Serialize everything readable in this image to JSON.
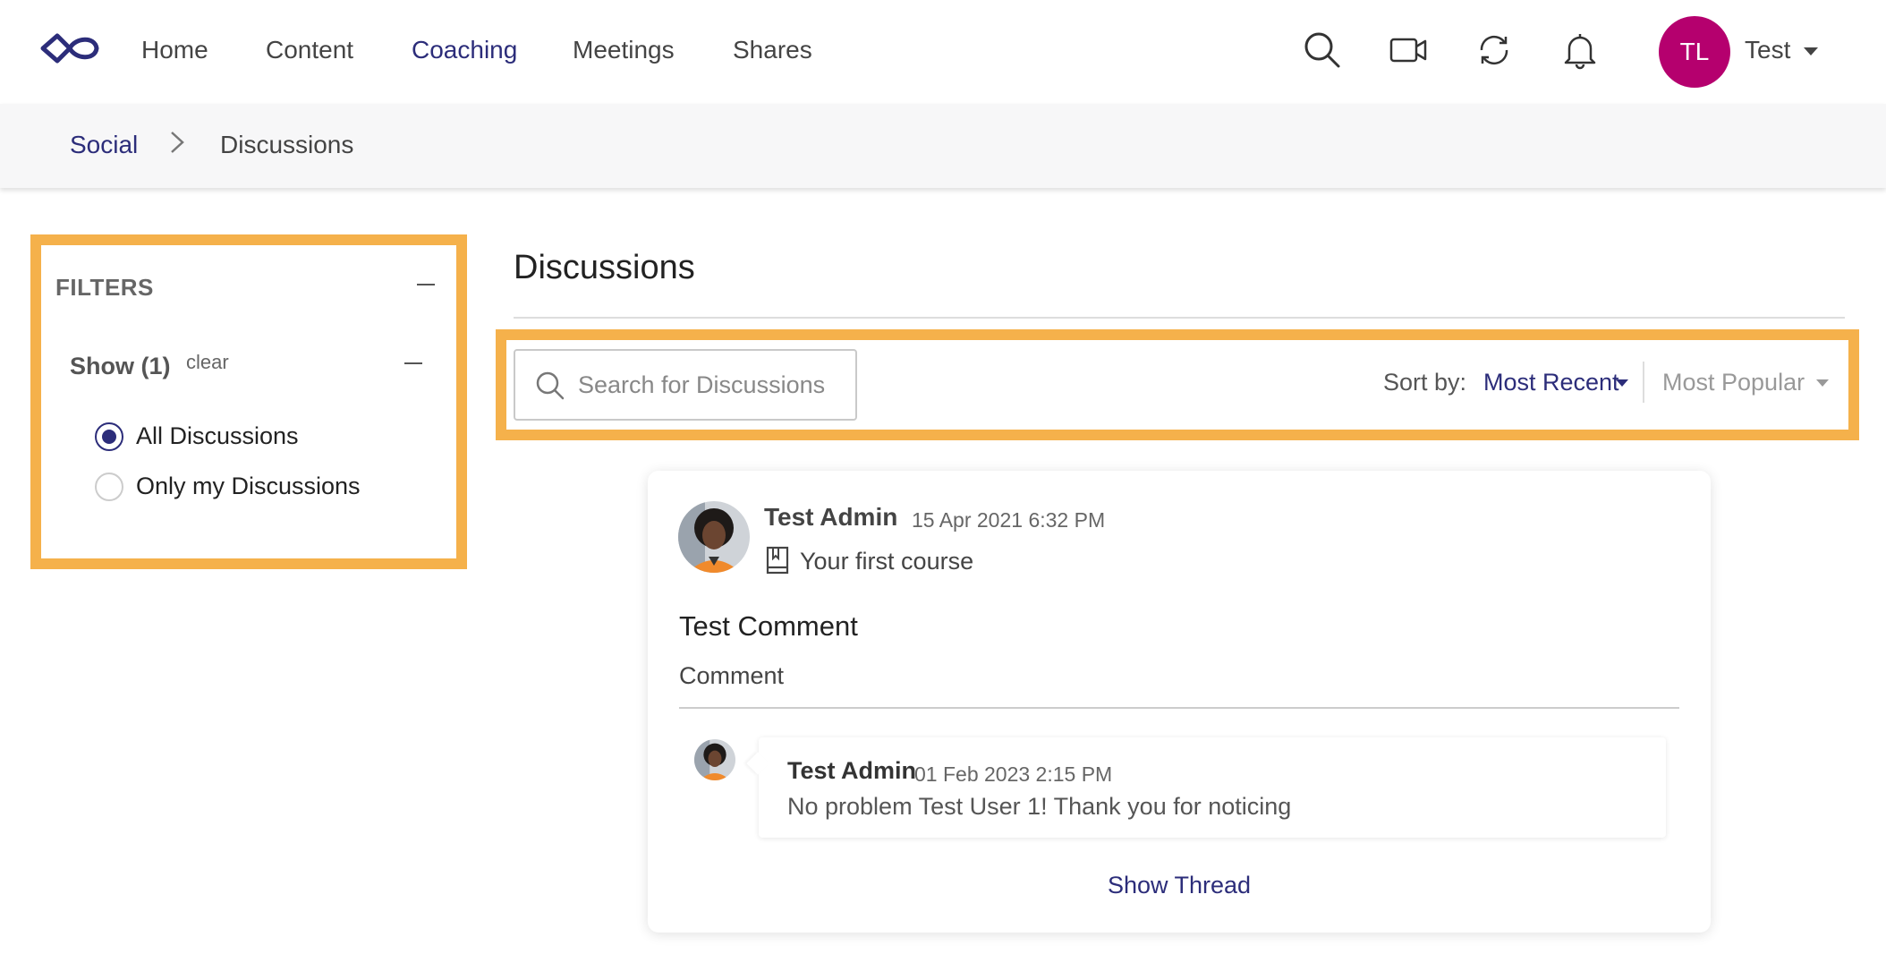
{
  "nav": {
    "items": [
      {
        "label": "Home"
      },
      {
        "label": "Content"
      },
      {
        "label": "Coaching"
      },
      {
        "label": "Meetings"
      },
      {
        "label": "Shares"
      }
    ],
    "active": "Coaching",
    "icons": [
      "search-icon",
      "video-camera-icon",
      "sync-icon",
      "bell-icon"
    ],
    "user": {
      "initials": "TL",
      "name": "Test",
      "avatar_color": "#b5006e"
    }
  },
  "breadcrumb": {
    "parent": "Social",
    "current": "Discussions"
  },
  "filters": {
    "title": "FILTERS",
    "show_label": "Show (1)",
    "clear_label": "clear",
    "options": [
      {
        "label": "All Discussions",
        "checked": true
      },
      {
        "label": "Only my Discussions",
        "checked": false
      }
    ]
  },
  "main": {
    "title": "Discussions",
    "search": {
      "placeholder": "Search for Discussions",
      "value": ""
    },
    "sort": {
      "label": "Sort by:",
      "options": [
        "Most Recent",
        "Most Popular"
      ],
      "selected": "Most Recent"
    }
  },
  "discussion": {
    "author": "Test Admin",
    "timestamp": "15 Apr 2021 6:32 PM",
    "course": "Your first course",
    "title": "Test Comment",
    "body": "Comment",
    "reply": {
      "author": "Test Admin",
      "timestamp": "01 Feb 2023 2:15 PM",
      "text": "No problem Test User 1! Thank you for noticing"
    },
    "show_thread_label": "Show Thread"
  },
  "colors": {
    "accent": "#2c2d7a",
    "highlight": "#f5b14b",
    "avatar": "#b5006e"
  }
}
